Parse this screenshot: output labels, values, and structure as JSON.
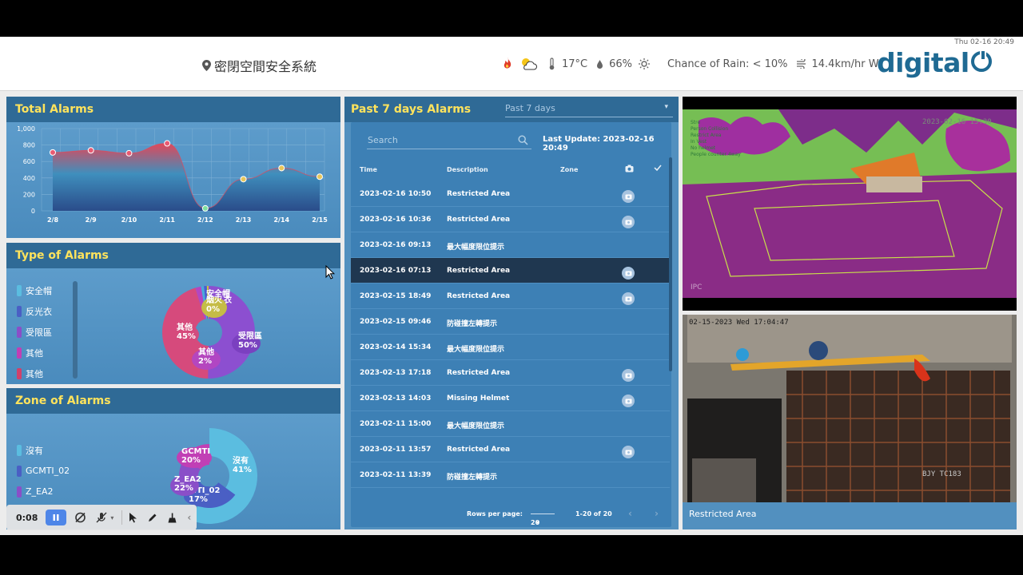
{
  "header": {
    "datetime": "Thu 02-16 20:49",
    "site_name": "密閉空間安全系統",
    "temperature": "17°C",
    "humidity": "66%",
    "rain": "Chance of Rain: < 10%",
    "wind": "14.4km/hr W",
    "logo": "digital"
  },
  "total_alarms": {
    "title": "Total Alarms",
    "chart_data": {
      "type": "area",
      "x": [
        "2/8",
        "2/9",
        "2/10",
        "2/11",
        "2/12",
        "2/13",
        "2/14",
        "2/15"
      ],
      "y": [
        710,
        735,
        700,
        820,
        30,
        385,
        520,
        415
      ],
      "ylim": [
        0,
        1000
      ],
      "yticks": [
        "1,000",
        "800",
        "600",
        "400",
        "200",
        "0"
      ],
      "grid": true
    }
  },
  "type_of_alarms": {
    "title": "Type of Alarms",
    "legend": [
      "安全帽",
      "反光衣",
      "受限區",
      "其他",
      "其他"
    ],
    "legend_colors": [
      "#5bbde0",
      "#4a5fc4",
      "#8a4fc8",
      "#c13fb5",
      "#d0416b"
    ],
    "chart_data": {
      "type": "pie",
      "slices": [
        {
          "label": "受限區",
          "value": 50,
          "color": "#8c4fd0"
        },
        {
          "label": "其他",
          "value": 45,
          "color": "#d64a7c"
        },
        {
          "label": "其他",
          "value": 2,
          "color": "#b346c2"
        },
        {
          "label": "安全帽",
          "value": 1,
          "color": "#4aa9dc"
        },
        {
          "label": "反光衣",
          "value": 1,
          "color": "#4b5bd0"
        },
        {
          "label": "烟火",
          "value": 0,
          "color": "#c8c23e"
        }
      ],
      "labels": [
        {
          "name": "受限區",
          "pct": "50%"
        },
        {
          "name": "其他",
          "pct": "45%"
        },
        {
          "name": "其他",
          "pct": "2%"
        },
        {
          "name": "烟火",
          "pct": "0%"
        },
        {
          "name": "安全帽",
          "pct": ""
        },
        {
          "name": "衣",
          "pct": ""
        }
      ]
    }
  },
  "zone_of_alarms": {
    "title": "Zone of Alarms",
    "legend": [
      "沒有",
      "GCMTI_02",
      "Z_EA2"
    ],
    "legend_colors": [
      "#5bbde0",
      "#4a5fc4",
      "#8a4fc8"
    ],
    "chart_data": {
      "type": "pie",
      "slices": [
        {
          "label": "沒有",
          "value": 41,
          "color": "#5bbde0"
        },
        {
          "label": "GCMTI_02",
          "value": 17,
          "color": "#4a5fc4"
        },
        {
          "label": "Z_EA2",
          "value": 22,
          "color": "#8a4fc8"
        },
        {
          "label": "GCMTI",
          "value": 20,
          "color": "#c13fb5"
        }
      ],
      "labels": [
        {
          "name": "沒有",
          "pct": "41%"
        },
        {
          "name": "MTI_02",
          "pct": "17%"
        },
        {
          "name": "Z_EA2",
          "pct": "22%"
        },
        {
          "name": "GCMTI",
          "pct": "20%"
        }
      ]
    }
  },
  "past_alarms": {
    "title": "Past 7 days Alarms",
    "range_value": "Past 7 days",
    "search_placeholder": "Search",
    "last_update": "Last Update: 2023-02-16 20:49",
    "columns": {
      "time": "Time",
      "description": "Description",
      "zone": "Zone"
    },
    "rows": [
      {
        "time": "2023-02-16 10:50",
        "description": "Restricted Area",
        "has_image": true
      },
      {
        "time": "2023-02-16 10:36",
        "description": "Restricted Area",
        "has_image": true
      },
      {
        "time": "2023-02-16 09:13",
        "description": "最大幅度限位提示",
        "has_image": false
      },
      {
        "time": "2023-02-16 07:13",
        "description": "Restricted Area",
        "has_image": true
      },
      {
        "time": "2023-02-15 18:49",
        "description": "Restricted Area",
        "has_image": true
      },
      {
        "time": "2023-02-15 09:46",
        "description": "防碰撞左轉提示",
        "has_image": false
      },
      {
        "time": "2023-02-14 15:34",
        "description": "最大幅度限位提示",
        "has_image": false
      },
      {
        "time": "2023-02-13 17:18",
        "description": "Restricted Area",
        "has_image": true
      },
      {
        "time": "2023-02-13 14:03",
        "description": "Missing Helmet",
        "has_image": true
      },
      {
        "time": "2023-02-11 15:00",
        "description": "最大幅度限位提示",
        "has_image": false
      },
      {
        "time": "2023-02-11 13:57",
        "description": "Restricted Area",
        "has_image": true
      },
      {
        "time": "2023-02-11 13:39",
        "description": "防碰撞左轉提示",
        "has_image": false
      }
    ],
    "selected_row": 3,
    "rows_per_page_label": "Rows per page:",
    "rows_per_page": "20",
    "page_info": "1-20 of 20"
  },
  "cameras": {
    "cam1_timestamp": "2023-02-16 15:30",
    "cam1_overlay": [
      "Stre",
      "Person Collision",
      "Restrict Area",
      "In Vest",
      "No helmet",
      "People counter 4way"
    ],
    "cam1_label": "IPC",
    "cam2_timestamp": "02-15-2023 Wed 17:04:47",
    "cam2_watermark": "BJY TC183",
    "cam2_caption": "Restricted Area"
  },
  "player": {
    "time": "0:08"
  }
}
